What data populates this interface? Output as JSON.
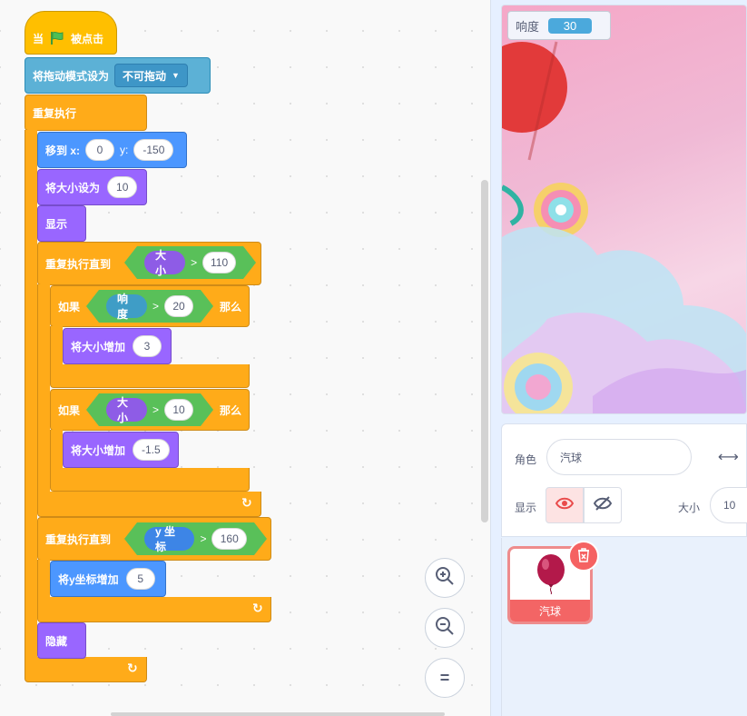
{
  "script": {
    "hat": {
      "when": "当",
      "clicked": "被点击"
    },
    "drag_mode": {
      "label": "将拖动模式设为",
      "value": "不可拖动"
    },
    "forever": {
      "label": "重复执行"
    },
    "goto": {
      "label": "移到 x:",
      "x": "0",
      "y_label": "y:",
      "y": "-150"
    },
    "set_size": {
      "label": "将大小设为",
      "value": "10"
    },
    "show": {
      "label": "显示"
    },
    "repeat_until_1": {
      "label": "重复执行直到",
      "reporter": "大小",
      "op": ">",
      "value": "110"
    },
    "if_1": {
      "label": "如果",
      "reporter": "响度",
      "op": ">",
      "value": "20",
      "then": "那么"
    },
    "change_size_1": {
      "label": "将大小增加",
      "value": "3"
    },
    "if_2": {
      "label": "如果",
      "reporter": "大小",
      "op": ">",
      "value": "10",
      "then": "那么"
    },
    "change_size_2": {
      "label": "将大小增加",
      "value": "-1.5"
    },
    "repeat_until_2": {
      "label": "重复执行直到",
      "reporter": "y 坐标",
      "op": ">",
      "value": "160"
    },
    "change_y": {
      "label": "将y坐标增加",
      "value": "5"
    },
    "hide": {
      "label": "隐藏"
    }
  },
  "zoom": {
    "in_icon": "zoom-in-icon",
    "out_icon": "zoom-out-icon",
    "reset_icon": "zoom-reset-icon"
  },
  "stage": {
    "monitor": {
      "label": "响度",
      "value": "30"
    }
  },
  "sprite_info": {
    "sprite_label": "角色",
    "sprite_name": "汽球",
    "show_label": "显示",
    "size_label": "大小",
    "size_value": "10"
  },
  "sprite_list": {
    "sprites": [
      {
        "name": "汽球",
        "selected": true
      }
    ]
  },
  "colors": {
    "events": "#ffbf00",
    "control": "#ffab19",
    "motion": "#4c97ff",
    "looks": "#9966ff",
    "sensing": "#5cb1d6",
    "operators": "#59c059"
  }
}
